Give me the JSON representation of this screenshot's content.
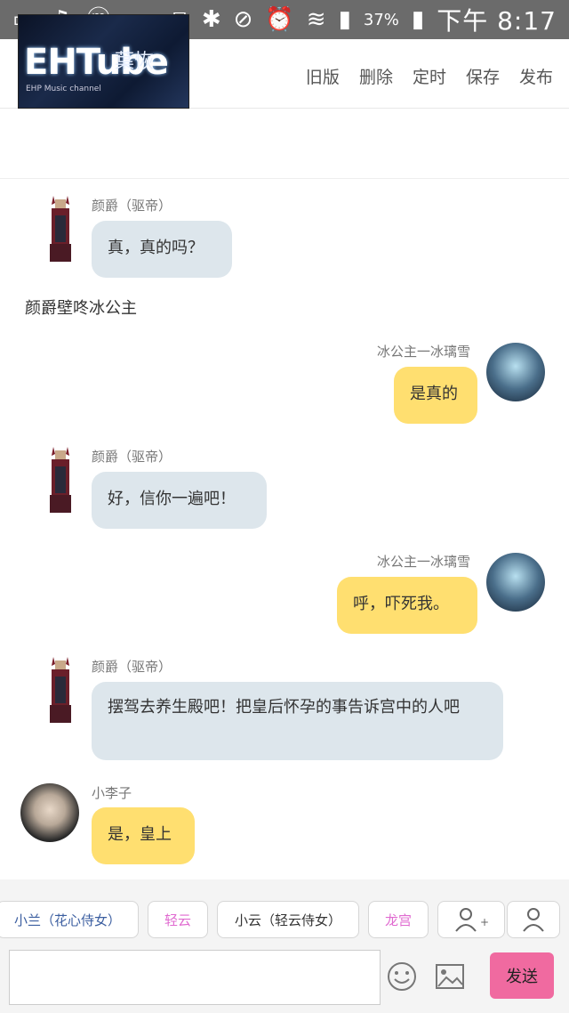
{
  "status_bar": {
    "battery": "37%",
    "time": "下午 8:17"
  },
  "toolbar": {
    "thumbnail_text": "EHTube",
    "thumbnail_caption": "葉恢",
    "thumbnail_sub": "EHP Music channel",
    "actions": [
      "旧版",
      "删除",
      "定时",
      "保存",
      "发布"
    ]
  },
  "messages": [
    {
      "sender": "颜爵（驱帝）",
      "text": "真，真的吗？",
      "side": "left",
      "color": "grey"
    },
    {
      "sender": "冰公主一冰璃雪",
      "text": "是真的",
      "side": "right",
      "color": "yellow"
    },
    {
      "sender": "颜爵（驱帝）",
      "text": "好，信你一遍吧！",
      "side": "left",
      "color": "grey"
    },
    {
      "sender": "冰公主一冰璃雪",
      "text": "呼，吓死我。",
      "side": "right",
      "color": "yellow"
    },
    {
      "sender": "颜爵（驱帝）",
      "text": "摆驾去养生殿吧！把皇后怀孕的事告诉宫中的人吧",
      "side": "left",
      "color": "grey"
    },
    {
      "sender": "小李子",
      "text": "是，皇上",
      "side": "left",
      "color": "yellow"
    }
  ],
  "narration": "颜爵壁咚冰公主",
  "character_chips": [
    "小兰（花心侍女）",
    "轻云",
    "小云（轻云侍女）",
    "龙宫"
  ],
  "send_label": "发送",
  "colors": {
    "grey_bubble": "#dde6ec",
    "yellow_bubble": "#ffdf70",
    "send_button": "#f06aa0",
    "status_bar": "#6b6b6b",
    "chip_light_pink": "#e06ad0"
  }
}
